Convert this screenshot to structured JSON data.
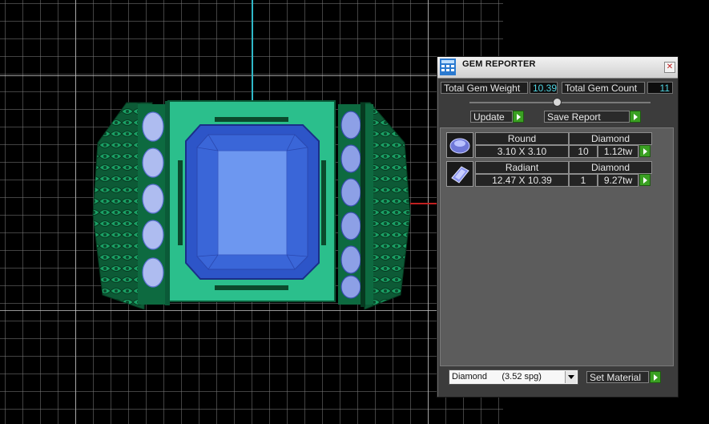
{
  "viewport": {
    "axis_y_color": "#2fb8c8",
    "axis_x_color": "#c02020",
    "ring_color": "#1e9a68",
    "gem_color": "#4a7de8"
  },
  "panel": {
    "title": "GEM REPORTER",
    "close_glyph": "✕",
    "total_weight_label": "Total Gem Weight",
    "total_weight_value": "10.39",
    "total_count_label": "Total Gem Count",
    "total_count_value": "11",
    "update_label": "Update",
    "save_report_label": "Save Report",
    "gems": [
      {
        "icon": "round-gem-icon",
        "shape": "Round",
        "material": "Diamond",
        "size": "3.10 X 3.10",
        "count": "10",
        "weight": "1.12tw"
      },
      {
        "icon": "radiant-gem-icon",
        "shape": "Radiant",
        "material": "Diamond",
        "size": "12.47 X 10.39",
        "count": "1",
        "weight": "9.27tw"
      }
    ],
    "material_select": "Diamond      (3.52 spg)",
    "set_material_label": "Set Material"
  }
}
